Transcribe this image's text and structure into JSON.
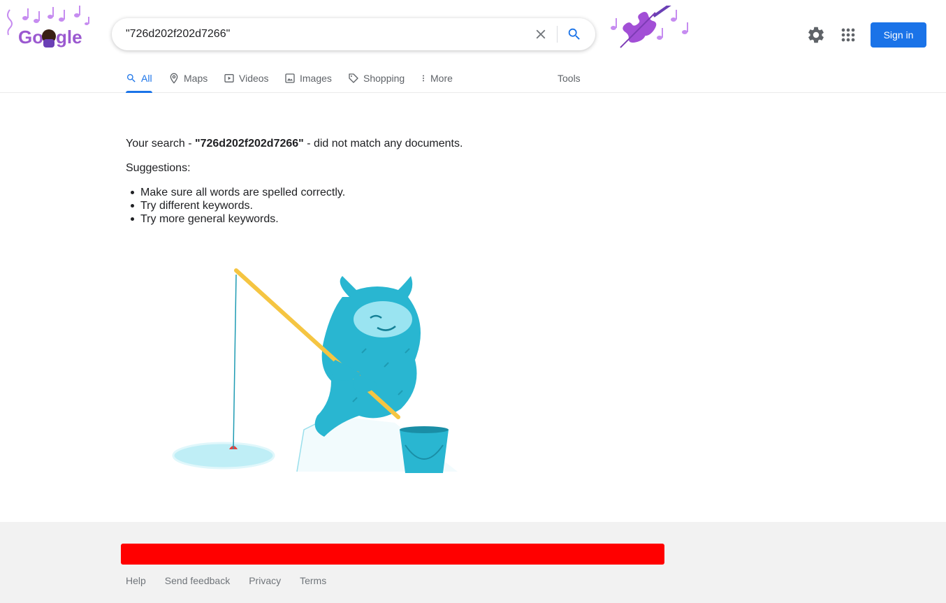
{
  "search": {
    "query": "\"726d202f202d7266\""
  },
  "header": {
    "signin_label": "Sign in"
  },
  "tabs": [
    {
      "label": "All",
      "icon": "search-icon"
    },
    {
      "label": "Maps",
      "icon": "map-pin-icon"
    },
    {
      "label": "Videos",
      "icon": "play-icon"
    },
    {
      "label": "Images",
      "icon": "image-icon"
    },
    {
      "label": "Shopping",
      "icon": "tag-icon"
    },
    {
      "label": "More",
      "icon": "more-vert-icon"
    }
  ],
  "tools_label": "Tools",
  "results": {
    "prefix": "Your search - ",
    "query": "\"726d202f202d7266\"",
    "suffix": " - did not match any documents.",
    "suggestions_label": "Suggestions:",
    "suggestions": [
      "Make sure all words are spelled correctly.",
      "Try different keywords.",
      "Try more general keywords."
    ]
  },
  "footer": {
    "links": [
      "Help",
      "Send feedback",
      "Privacy",
      "Terms"
    ]
  },
  "colors": {
    "accent": "#1a73e8",
    "footer_bg": "#f2f2f2",
    "red_banner": "#ff0000",
    "doodle_purple": "#b16ae8",
    "monster_teal": "#29b6d1"
  }
}
